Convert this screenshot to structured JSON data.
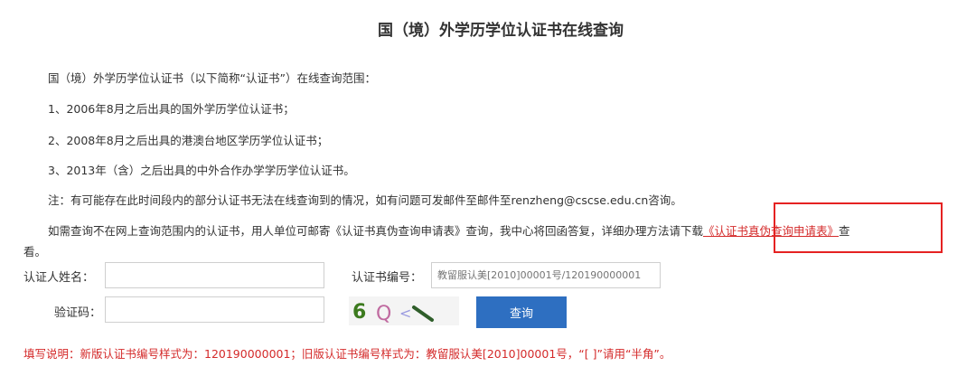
{
  "page": {
    "title": "国（境）外学历学位认证书在线查询"
  },
  "intro": "国（境）外学历学位认证书（以下简称“认证书”）在线查询范围：",
  "scope": [
    "1、2006年8月之后出具的国外学历学位认证书；",
    "2、2008年8月之后出具的港澳台地区学历学位认证书；",
    "3、2013年（含）之后出具的中外合作办学学历学位认证书。"
  ],
  "note": "注：有可能存在此时间段内的部分认证书无法在线查询到的情况，如有问题可发邮件至邮件至renzheng@cscse.edu.cn咨询。",
  "request": {
    "text_before": "如需查询不在网上查询范围内的认证书，用人单位可邮寄《认证书真伪查询申请表》查询，我中心将回函答复，详细办理方法请下载",
    "link_text": "《认证书真伪查询申请表》",
    "text_after": "查",
    "continuation": "看。"
  },
  "form": {
    "name_label": "认证人姓名：",
    "name_value": "",
    "cert_label": "认证书编号：",
    "cert_placeholder": "教留服认美[2010]00001号/120190000001",
    "code_label": "验证码：",
    "code_value": "",
    "captcha_text": "6 Q < \\",
    "submit_label": "查询"
  },
  "help_text": "填写说明：新版认证书编号样式为：120190000001；旧版认证书编号样式为：教留服认美[2010]00001号，“[ ]”请用“半角”。",
  "colors": {
    "accent_red": "#d42a2a",
    "button_blue": "#2e6fc1",
    "highlight_box": "#e52222"
  }
}
